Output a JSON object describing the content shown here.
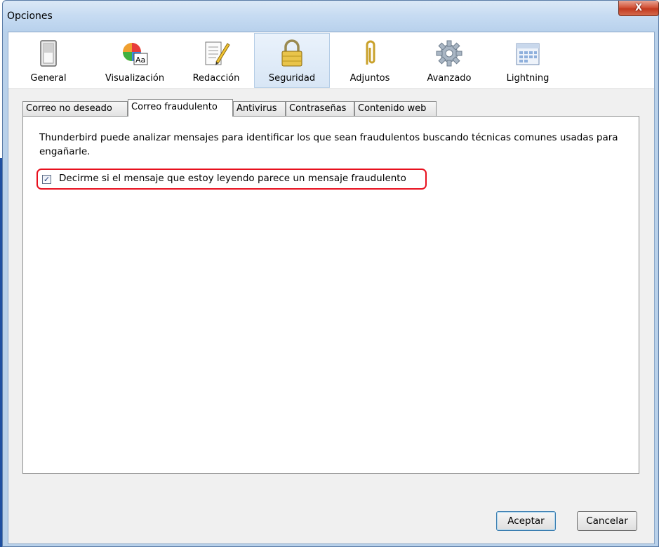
{
  "window": {
    "title": "Opciones",
    "close_label": "X"
  },
  "toolbar": {
    "panes": [
      {
        "label": "General",
        "icon": "switch-icon"
      },
      {
        "label": "Visualización",
        "icon": "font-colors-icon"
      },
      {
        "label": "Redacción",
        "icon": "compose-pencil-icon"
      },
      {
        "label": "Seguridad",
        "icon": "padlock-icon",
        "selected": true
      },
      {
        "label": "Adjuntos",
        "icon": "paperclip-icon"
      },
      {
        "label": "Avanzado",
        "icon": "gear-icon"
      },
      {
        "label": "Lightning",
        "icon": "calendar-icon"
      }
    ]
  },
  "tabs": [
    {
      "label": "Correo no deseado"
    },
    {
      "label": "Correo fraudulento",
      "active": true
    },
    {
      "label": "Antivirus"
    },
    {
      "label": "Contraseñas"
    },
    {
      "label": "Contenido web"
    }
  ],
  "panel": {
    "description": "Thunderbird puede analizar mensajes para identificar los que sean fraudulentos buscando técnicas comunes usadas para engañarle.",
    "checkbox_label": "Decirme si el mensaje que estoy leyendo parece un mensaje fraudulento",
    "checkbox_checked": true
  },
  "buttons": {
    "accept": "Aceptar",
    "cancel": "Cancelar"
  },
  "colors": {
    "highlight_border": "#e8101e",
    "selected_pane": "#d8e6f5"
  }
}
